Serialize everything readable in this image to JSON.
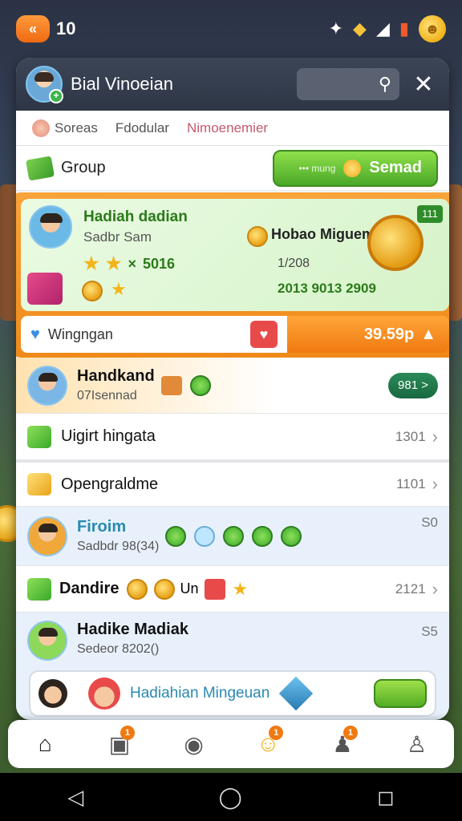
{
  "status": {
    "level": "10",
    "level_badge_icon": "back-arrow-icon",
    "icons": [
      "tools-icon",
      "gem-icon",
      "signal-icon",
      "battery-icon",
      "coin-emoji-icon"
    ]
  },
  "panel": {
    "title": "Bial Vinoeian",
    "search_icon": "search-icon",
    "close_icon": "close-icon"
  },
  "tabs": [
    {
      "label": "Soreas"
    },
    {
      "label": "Fdodular"
    },
    {
      "label": "Nimoenemier"
    }
  ],
  "group": {
    "label": "Group",
    "send_small": "••• mung",
    "send_label": "Semad"
  },
  "featured": {
    "name": "Hadiah dadian",
    "subtitle": "Sadbr Sam",
    "stars_value": "5016",
    "reward_title": "Hobao Miguem",
    "badge": "111",
    "value1": "1/208",
    "value2": "2013 9013 2909",
    "footer_label": "Wingngan",
    "footer_value": "39.59p"
  },
  "rows": [
    {
      "name": "Handkand",
      "sub": "07Isennad",
      "button": "981 >"
    },
    {
      "name": "Uigirt hingata",
      "value": "1301"
    },
    {
      "name": "Opengraldme",
      "value": "1101"
    },
    {
      "name": "Firoim",
      "sub": "Sadbdr 98(34)",
      "value": "S0"
    },
    {
      "name": "Dandire",
      "mid": "Un",
      "value": "2121"
    },
    {
      "name": "Hadike Madiak",
      "sub": "Sedeor 8202()",
      "value": "S5"
    }
  ],
  "promo": {
    "text": "Hadiahian Mingeuan"
  },
  "bottom_nav": [
    {
      "icon": "home-icon",
      "badge": ""
    },
    {
      "icon": "calendar-icon",
      "badge": "1"
    },
    {
      "icon": "group-icon",
      "badge": ""
    },
    {
      "icon": "smiley-icon",
      "badge": "1"
    },
    {
      "icon": "friend-icon",
      "badge": "1"
    },
    {
      "icon": "profile-icon",
      "badge": ""
    }
  ],
  "colors": {
    "accent_orange": "#f07a10",
    "accent_green": "#4aa828",
    "panel_header": "#2e3646"
  }
}
